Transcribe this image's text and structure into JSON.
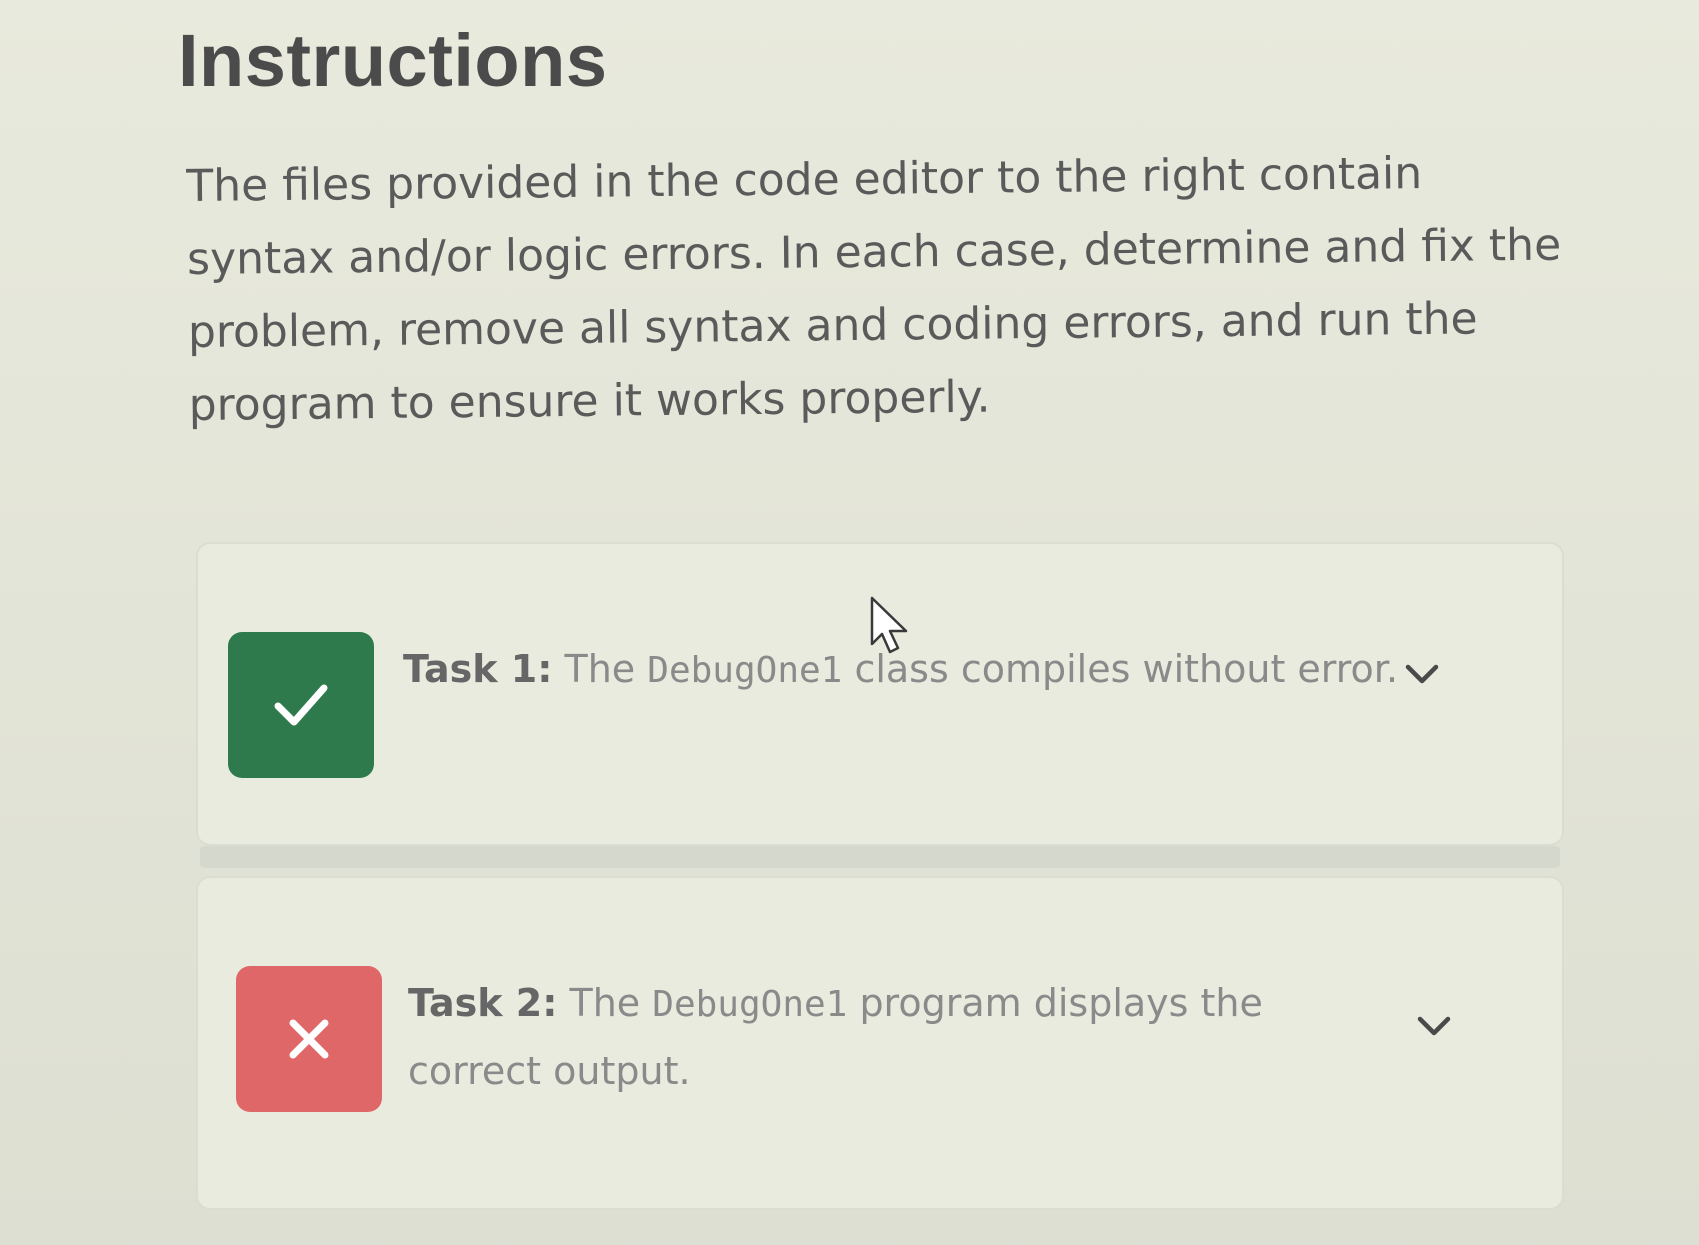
{
  "header": {
    "title": "Instructions"
  },
  "intro": {
    "text": "The files provided in the code editor to the right contain syntax and/or logic errors. In each case, determine and fix the problem, remove all syntax and coding errors, and run the program to ensure it works properly."
  },
  "tasks": [
    {
      "label": "Task 1:",
      "text_before": "The ",
      "code": "DebugOne1",
      "text_after": " class compiles without error.",
      "status": "pass",
      "status_icon": "check-icon",
      "status_color": "#2f7a4c"
    },
    {
      "label": "Task 2:",
      "text_before": "The ",
      "code": "DebugOne1",
      "text_after": " program displays the correct output.",
      "status": "fail",
      "status_icon": "x-icon",
      "status_color": "#e06767"
    }
  ],
  "colors": {
    "background": "#e6e8da",
    "title": "#4b4b4b",
    "body_text": "#5a5a5a",
    "task_text": "#8a8a8a"
  }
}
